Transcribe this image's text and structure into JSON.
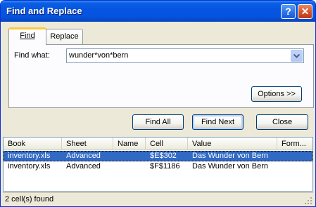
{
  "window": {
    "title": "Find and Replace",
    "help_glyph": "?",
    "close_glyph": "✕"
  },
  "tabs": [
    {
      "label": "Find",
      "selected": true
    },
    {
      "label": "Replace",
      "selected": false
    }
  ],
  "find": {
    "label": "Find what:",
    "value": "wunder*von*bern"
  },
  "buttons": {
    "options": "Options >>",
    "find_all": "Find All",
    "find_next": "Find Next",
    "close": "Close"
  },
  "results": {
    "columns": [
      "Book",
      "Sheet",
      "Name",
      "Cell",
      "Value",
      "Form..."
    ],
    "rows": [
      {
        "book": "inventory.xls",
        "sheet": "Advanced",
        "name": "",
        "cell": "$E$302",
        "value": "Das Wunder von Bern",
        "formula": "",
        "selected": true
      },
      {
        "book": "inventory.xls",
        "sheet": "Advanced",
        "name": "",
        "cell": "$F$1186",
        "value": "Das Wunder von Bern",
        "formula": "",
        "selected": false
      }
    ]
  },
  "status": {
    "text": "2 cell(s) found"
  },
  "colors": {
    "titlebar": "#0554e3",
    "selection": "#316ac5",
    "dialog_bg": "#ece9d8",
    "tab_highlight": "#ffc83c"
  },
  "icons": {
    "help": "help-icon",
    "close": "close-icon",
    "dropdown": "chevron-down-icon",
    "grip": "resize-grip-icon"
  }
}
